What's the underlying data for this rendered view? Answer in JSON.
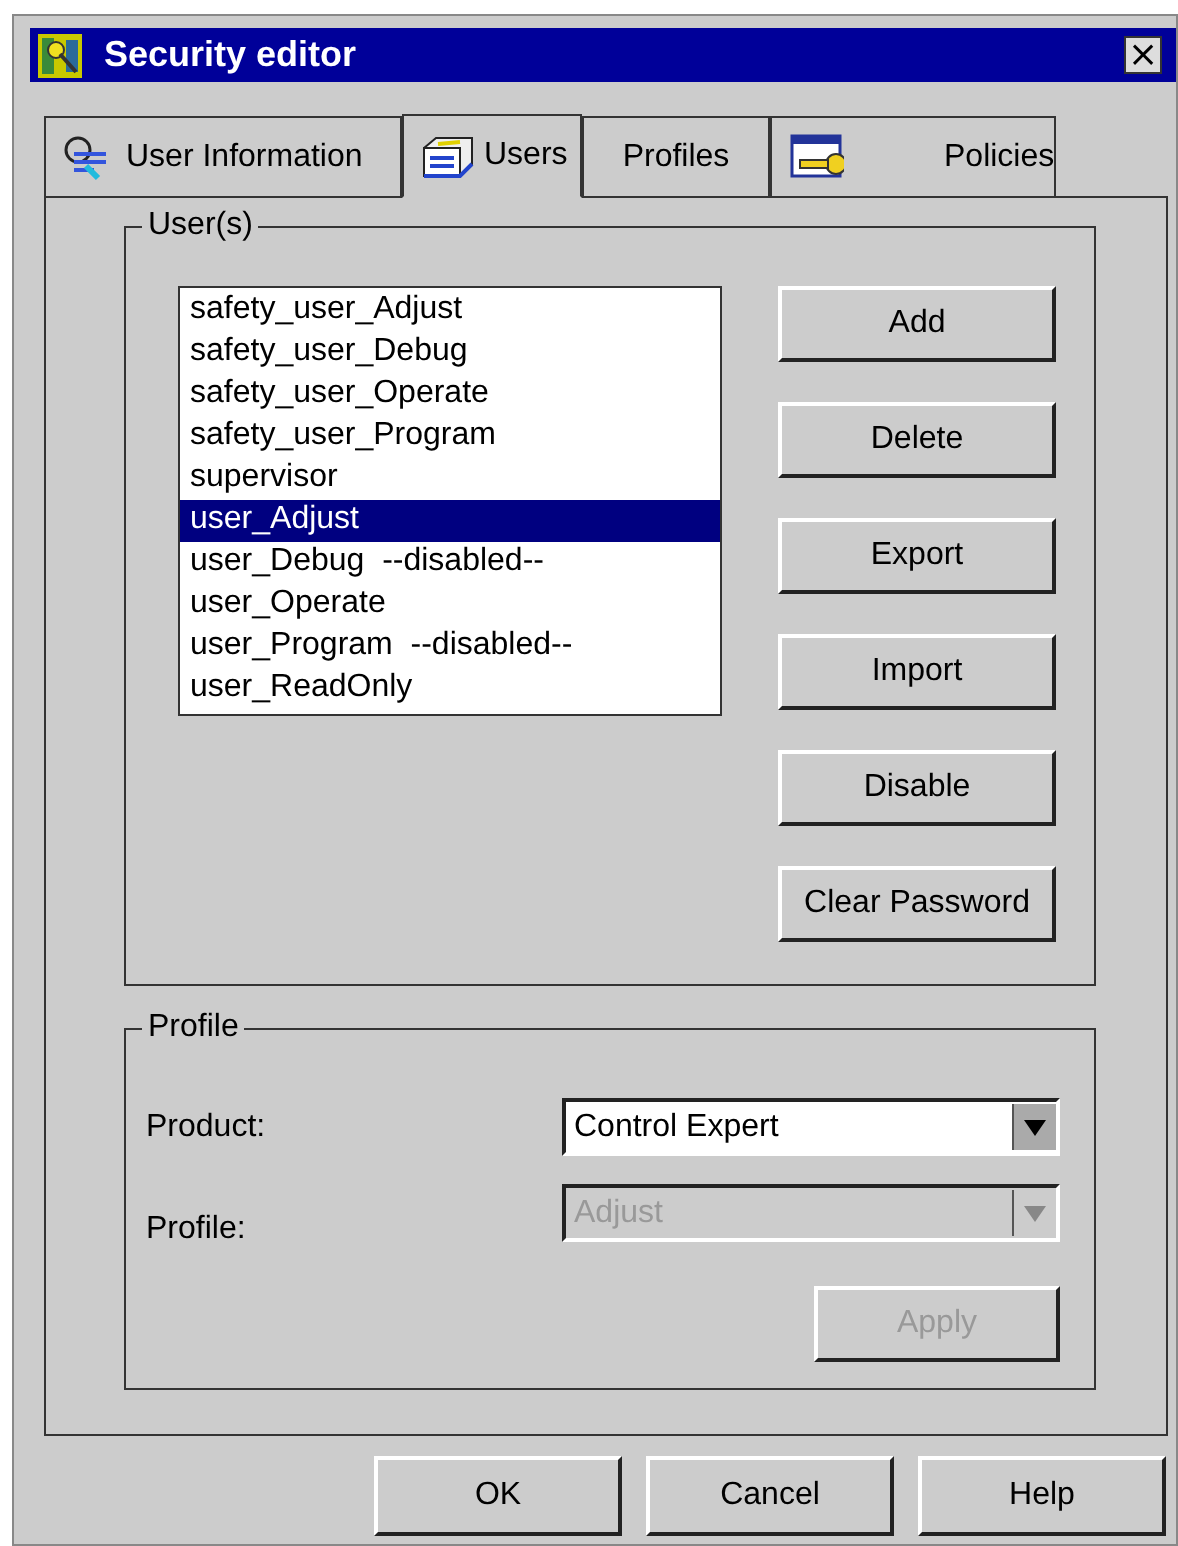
{
  "window": {
    "title": "Security editor",
    "close": "×"
  },
  "tabs": [
    {
      "label": "User Information",
      "selected": false
    },
    {
      "label": "Users",
      "selected": true
    },
    {
      "label": "Profiles",
      "selected": false
    },
    {
      "label": "Policies",
      "selected": false
    }
  ],
  "users_group": {
    "title": "User(s)",
    "users": [
      {
        "name": "safety_user_Adjust",
        "selected": false
      },
      {
        "name": "safety_user_Debug",
        "selected": false
      },
      {
        "name": "safety_user_Operate",
        "selected": false
      },
      {
        "name": "safety_user_Program",
        "selected": false
      },
      {
        "name": "supervisor",
        "selected": false
      },
      {
        "name": "user_Adjust",
        "selected": true
      },
      {
        "name": "user_Debug  --disabled--",
        "selected": false
      },
      {
        "name": "user_Operate",
        "selected": false
      },
      {
        "name": "user_Program  --disabled--",
        "selected": false
      },
      {
        "name": "user_ReadOnly",
        "selected": false
      }
    ],
    "buttons": [
      "Add",
      "Delete",
      "Export",
      "Import",
      "Disable",
      "Clear Password"
    ]
  },
  "profile_group": {
    "title": "Profile",
    "fields": [
      {
        "label": "Product:",
        "value": "Control Expert",
        "disabled": false
      },
      {
        "label": "Profile:",
        "value": "Adjust",
        "disabled": true
      }
    ],
    "apply": {
      "label": "Apply",
      "disabled": true
    }
  },
  "buttons": [
    "OK",
    "Cancel",
    "Help"
  ]
}
